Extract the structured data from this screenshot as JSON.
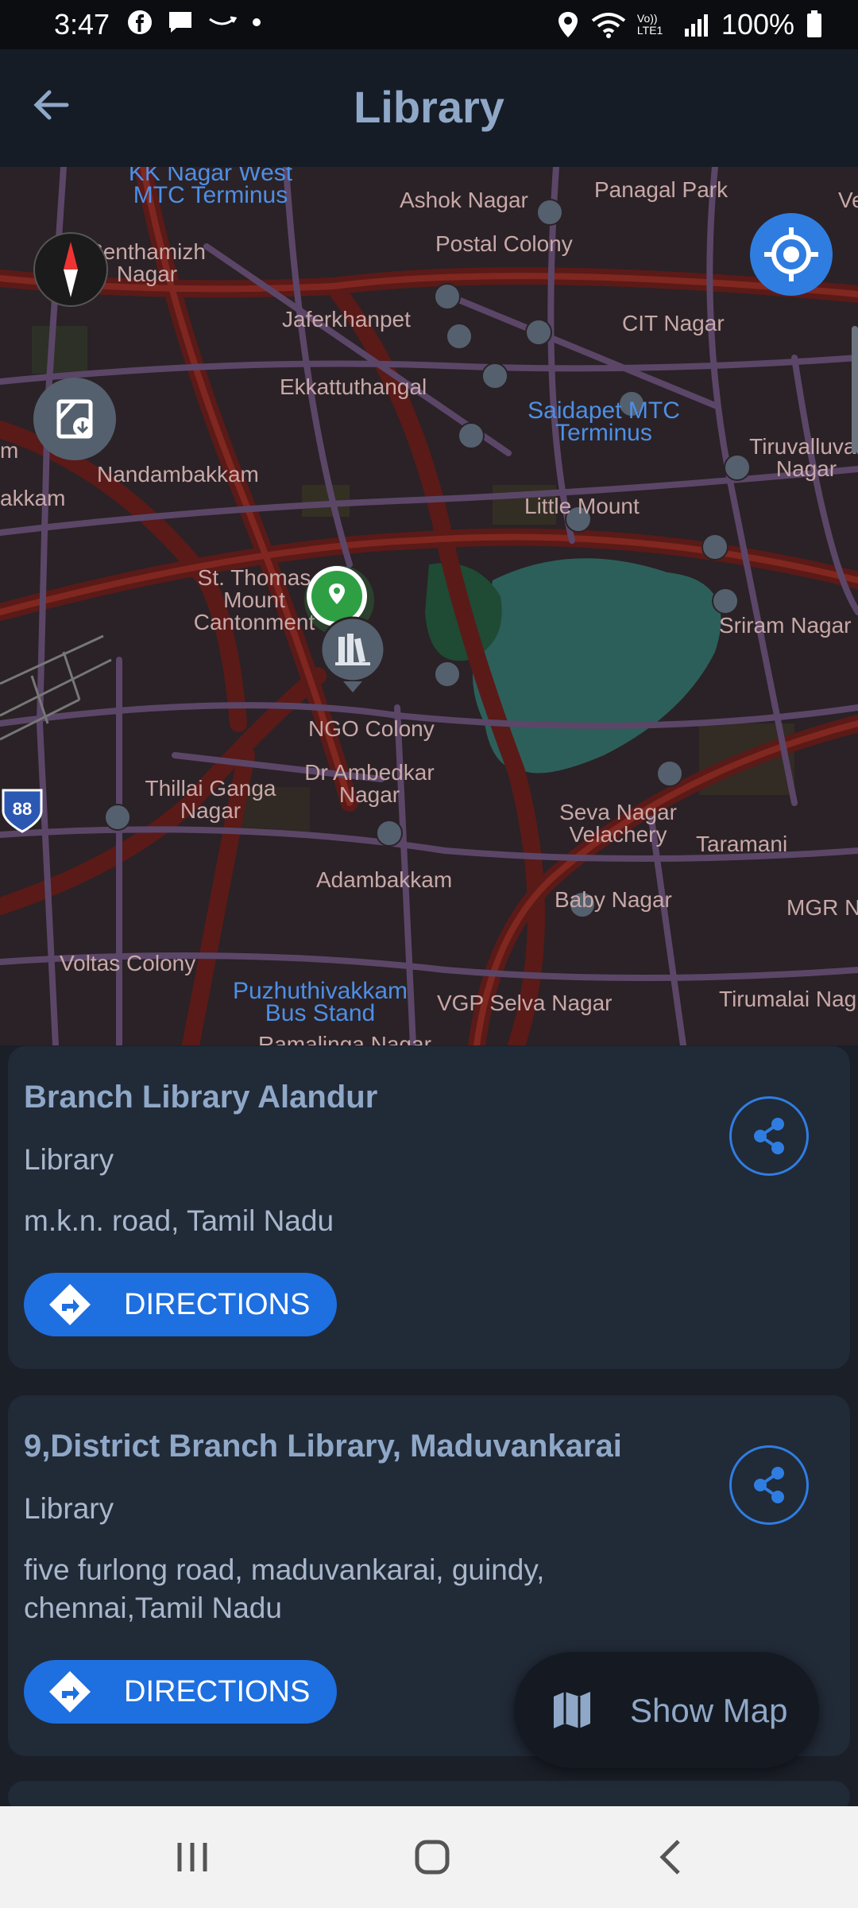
{
  "status_bar": {
    "time": "3:47",
    "battery": "100%",
    "volte": "Vo)) LTE1"
  },
  "app_bar": {
    "title": "Library"
  },
  "map": {
    "labels": [
      "KK Nagar West MTC Terminus",
      "Ashok Nagar",
      "Panagal Park",
      "Ve",
      "Senthamizh Nagar",
      "Postal Colony",
      "Jaferkhanpet",
      "CIT Nagar",
      "Ekkattuthangal",
      "Saidapet MTC Terminus",
      "Tiruvalluvar Nagar",
      "m",
      "Nandambakkam",
      "akkam",
      "Little Mount",
      "St. Thomas Mount Cantonment",
      "Sriram Nagar",
      "NGO Colony",
      "Dr Ambedkar Nagar",
      "Thillai Ganga Nagar",
      "Seva Nagar Velachery",
      "Taramani",
      "Adambakkam",
      "Baby Nagar",
      "MGR N",
      "Voltas Colony",
      "Puzhuthivakkam Bus Stand",
      "VGP Selva Nagar",
      "Tirumalai Nag",
      "Ramalinga Nagar"
    ],
    "shield": "88"
  },
  "results": [
    {
      "name": "Branch Library Alandur",
      "category": "Library",
      "address": "m.k.n. road, Tamil Nadu",
      "directions_label": "DIRECTIONS"
    },
    {
      "name": "9,District Branch Library, Maduvankarai",
      "category": "Library",
      "address": "five furlong road, maduvankarai, guindy, chennai,Tamil Nadu",
      "directions_label": "DIRECTIONS"
    }
  ],
  "show_map_label": "Show Map",
  "colors": {
    "accent": "#1e6fe0",
    "title": "#8fa8c8",
    "card": "#212a37",
    "map_bg": "#2a2226",
    "water": "#2c5f5a",
    "pin_green": "#2ea043"
  }
}
